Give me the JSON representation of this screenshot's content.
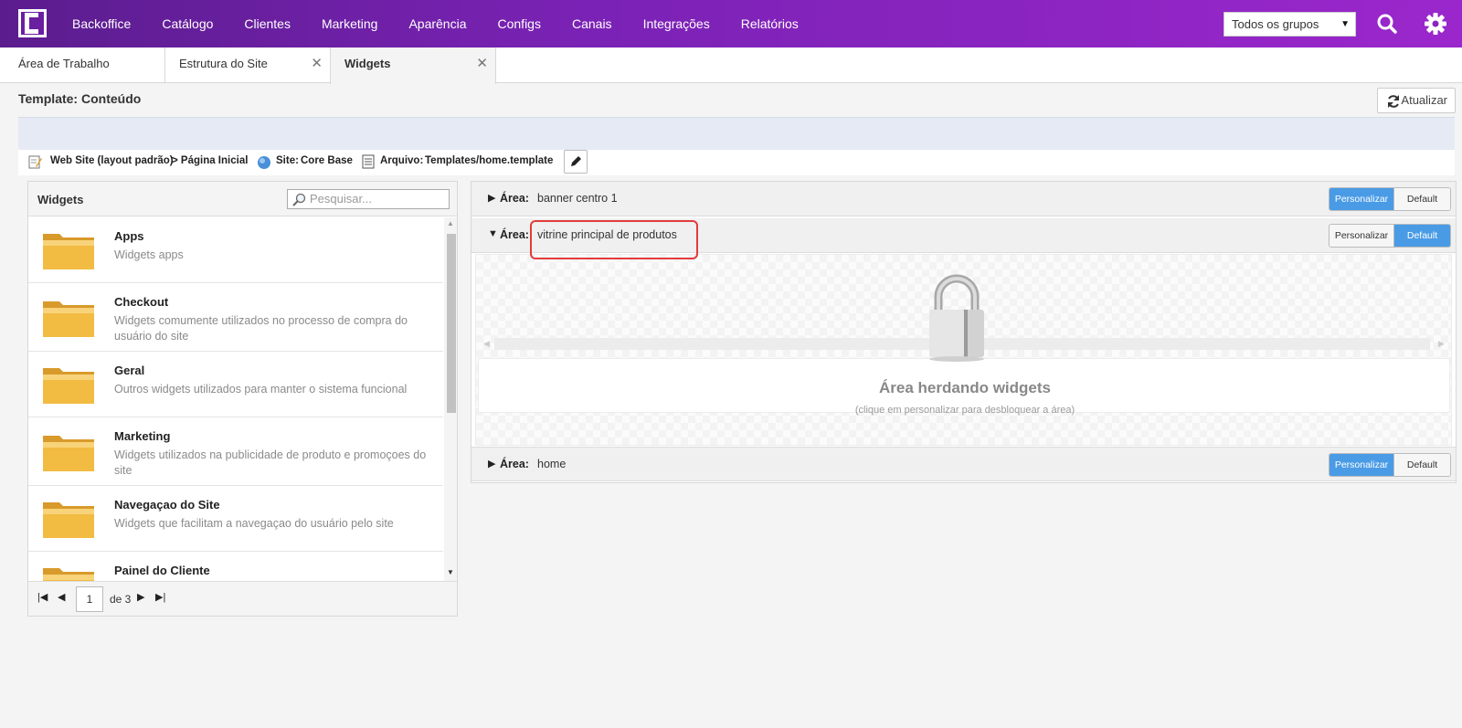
{
  "topbar": {
    "nav": [
      "Backoffice",
      "Catálogo",
      "Clientes",
      "Marketing",
      "Aparência",
      "Configs",
      "Canais",
      "Integrações",
      "Relatórios"
    ],
    "group_select": "Todos os grupos"
  },
  "tabs": [
    "Área de Trabalho",
    "Estrutura do Site",
    "Widgets"
  ],
  "page": {
    "title": "Template: Conteúdo",
    "refresh_label": "Atualizar"
  },
  "infobar": {
    "site_layout": "Web Site (layout padrão)",
    "page": "> Página Inicial",
    "site_label": "Site:",
    "site_value": "Core Base",
    "file_label": "Arquivo:",
    "file_value": "Templates/home.template"
  },
  "widgets_panel": {
    "title": "Widgets",
    "search_placeholder": "Pesquisar...",
    "items": [
      {
        "name": "Apps",
        "desc": "Widgets apps"
      },
      {
        "name": "Checkout",
        "desc": "Widgets comumente utilizados no processo de compra do usuário do site"
      },
      {
        "name": "Geral",
        "desc": "Outros widgets utilizados para manter o sistema funcional"
      },
      {
        "name": "Marketing",
        "desc": "Widgets utilizados na publicidade de produto e promoçoes do site"
      },
      {
        "name": "Navegaçao do Site",
        "desc": "Widgets que facilitam a navegaçao do usuário pelo site"
      },
      {
        "name": "Painel do Cliente",
        "desc": ""
      }
    ],
    "pager": {
      "page": "1",
      "of": "de 3"
    }
  },
  "areas": {
    "label": "Área:",
    "btn_personalizar": "Personalizar",
    "btn_default": "Default",
    "rows": [
      {
        "value": "banner centro 1",
        "expanded": false,
        "active": "personalizar"
      },
      {
        "value": "vitrine principal de produtos",
        "expanded": true,
        "active": "default"
      },
      {
        "value": "home",
        "expanded": false,
        "active": "personalizar"
      }
    ],
    "locked_title": "Área herdando widgets",
    "locked_sub": "(clique em personalizar para desbloquear a área)"
  },
  "colors": {
    "brand_start": "#5b1d8e",
    "brand_end": "#9b27cc",
    "accent_blue": "#4a9be6",
    "highlight_red": "#e23b3b"
  }
}
